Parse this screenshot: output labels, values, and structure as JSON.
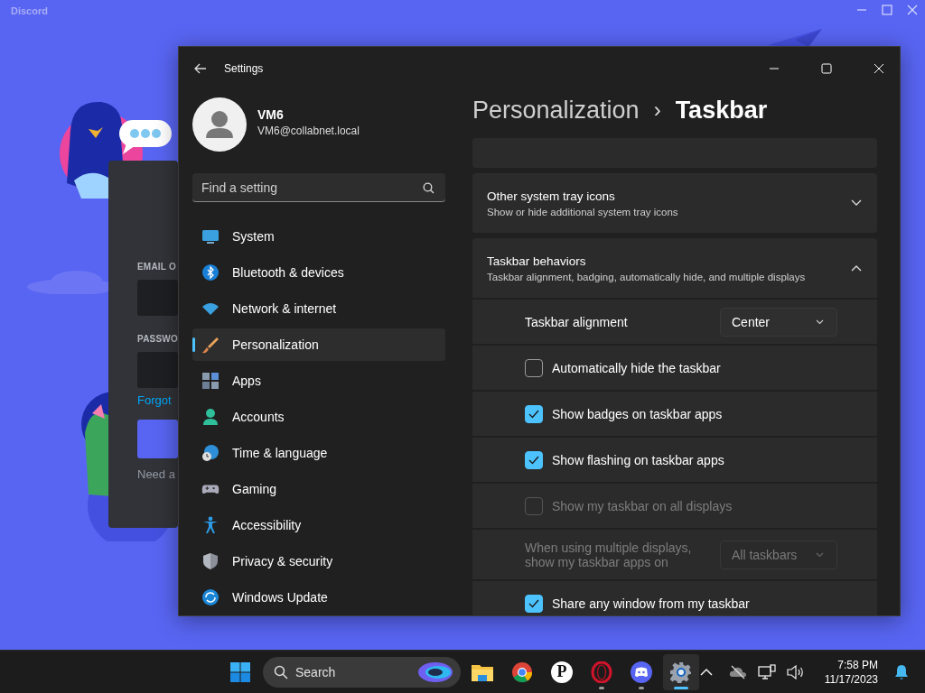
{
  "desktop_app": {
    "logo": "Discord",
    "login": {
      "email_label": "EMAIL O",
      "password_label": "PASSWO",
      "forgot_link": "Forgot",
      "register_text": "Need a"
    }
  },
  "settings": {
    "title": "Settings",
    "user": {
      "name": "VM6",
      "email": "VM6@collabnet.local"
    },
    "search": {
      "placeholder": "Find a setting"
    },
    "nav": [
      {
        "label": "System",
        "selected": false
      },
      {
        "label": "Bluetooth & devices",
        "selected": false
      },
      {
        "label": "Network & internet",
        "selected": false
      },
      {
        "label": "Personalization",
        "selected": true
      },
      {
        "label": "Apps",
        "selected": false
      },
      {
        "label": "Accounts",
        "selected": false
      },
      {
        "label": "Time & language",
        "selected": false
      },
      {
        "label": "Gaming",
        "selected": false
      },
      {
        "label": "Accessibility",
        "selected": false
      },
      {
        "label": "Privacy & security",
        "selected": false
      },
      {
        "label": "Windows Update",
        "selected": false
      }
    ],
    "breadcrumb": {
      "parent": "Personalization",
      "separator": "›",
      "current": "Taskbar"
    },
    "sections": [
      {
        "kind": "blank"
      },
      {
        "kind": "expander",
        "title": "Other system tray icons",
        "subtitle": "Show or hide additional system tray icons",
        "expanded": false
      },
      {
        "kind": "expander",
        "title": "Taskbar behaviors",
        "subtitle": "Taskbar alignment, badging, automatically hide, and multiple displays",
        "expanded": true,
        "rows": [
          {
            "kind": "dropdown",
            "label": "Taskbar alignment",
            "value": "Center",
            "disabled": false
          },
          {
            "kind": "checkbox",
            "label": "Automatically hide the taskbar",
            "checked": false,
            "disabled": false
          },
          {
            "kind": "checkbox",
            "label": "Show badges on taskbar apps",
            "checked": true,
            "disabled": false
          },
          {
            "kind": "checkbox",
            "label": "Show flashing on taskbar apps",
            "checked": true,
            "disabled": false
          },
          {
            "kind": "checkbox",
            "label": "Show my taskbar on all displays",
            "checked": false,
            "disabled": true
          },
          {
            "kind": "dropdown",
            "label": "When using multiple displays, show my taskbar apps on",
            "value": "All taskbars",
            "disabled": true
          },
          {
            "kind": "checkbox",
            "label": "Share any window from my taskbar",
            "checked": true,
            "disabled": false
          }
        ]
      }
    ]
  },
  "taskbar": {
    "search": {
      "placeholder": "Search"
    },
    "apps": [
      {
        "kind": "folder",
        "running": false,
        "selected": false
      },
      {
        "kind": "globe",
        "running": false,
        "selected": false
      },
      {
        "kind": "letter",
        "glyph": "P",
        "running": false,
        "selected": false
      },
      {
        "kind": "ring",
        "running": true,
        "selected": false
      },
      {
        "kind": "chat",
        "running": true,
        "selected": false
      },
      {
        "kind": "gear",
        "running": true,
        "selected": true
      }
    ],
    "clock": {
      "time": "7:58 PM",
      "date": "11/17/2023"
    }
  }
}
